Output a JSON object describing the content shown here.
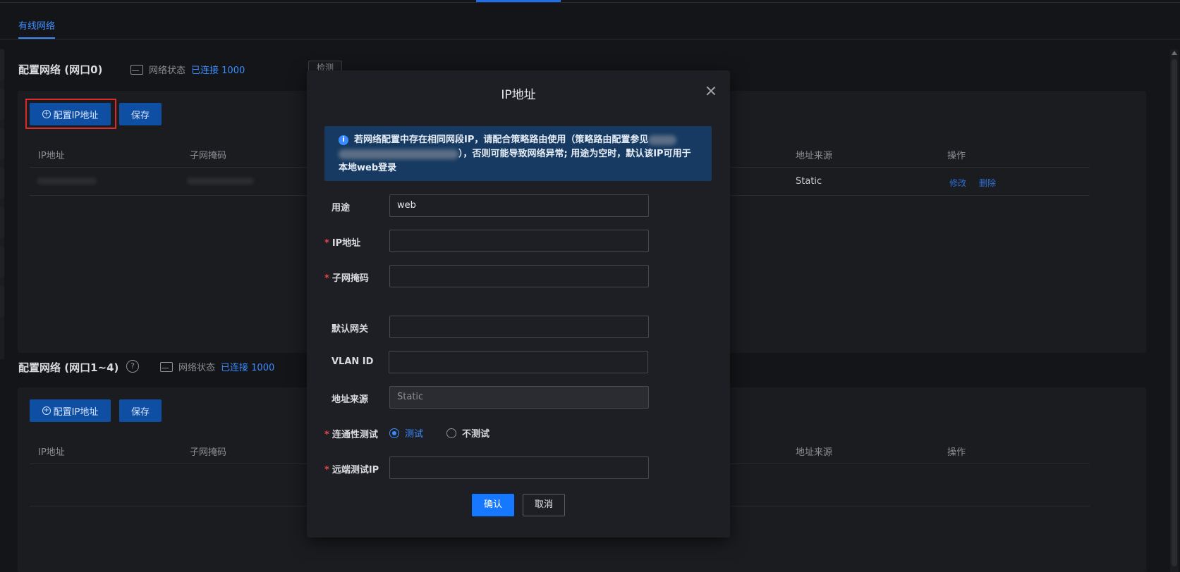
{
  "tabs": {
    "wired": "有线网络"
  },
  "section0": {
    "title": "配置网络 (网口0)",
    "status_label": "网络状态",
    "status_value": "已连接 1000",
    "detect_label": "检测",
    "config_btn": "配置IP地址",
    "save_btn": "保存",
    "columns": [
      "IP地址",
      "子网掩码",
      "地址来源",
      "操作"
    ],
    "row": {
      "source": "Static",
      "edit": "修改",
      "delete": "删除"
    }
  },
  "section1": {
    "title": "配置网络 (网口1~4)",
    "help": "?",
    "status_label": "网络状态",
    "status_value": "已连接 1000",
    "config_btn": "配置IP地址",
    "save_btn": "保存",
    "columns": [
      "IP地址",
      "子网掩码",
      "地址来源",
      "操作"
    ]
  },
  "modal": {
    "title": "IP地址",
    "alert_part1": "若网络配置中存在相同网段IP，请配合策略路由使用（策略路由配置参见",
    "alert_part2": "），否则可能导致网络异常; 用途为空时，默认该IP可用于本地web登录",
    "fields": {
      "usage_label": "用途",
      "usage_value": "web",
      "ip_label": "IP地址",
      "mask_label": "子网掩码",
      "gateway_label": "默认网关",
      "vlan_label": "VLAN ID",
      "source_label": "地址来源",
      "source_value": "Static",
      "conn_label": "连通性测试",
      "conn_test": "测试",
      "conn_notest": "不测试",
      "remote_label": "远端测试IP"
    },
    "confirm": "确认",
    "cancel": "取消"
  }
}
